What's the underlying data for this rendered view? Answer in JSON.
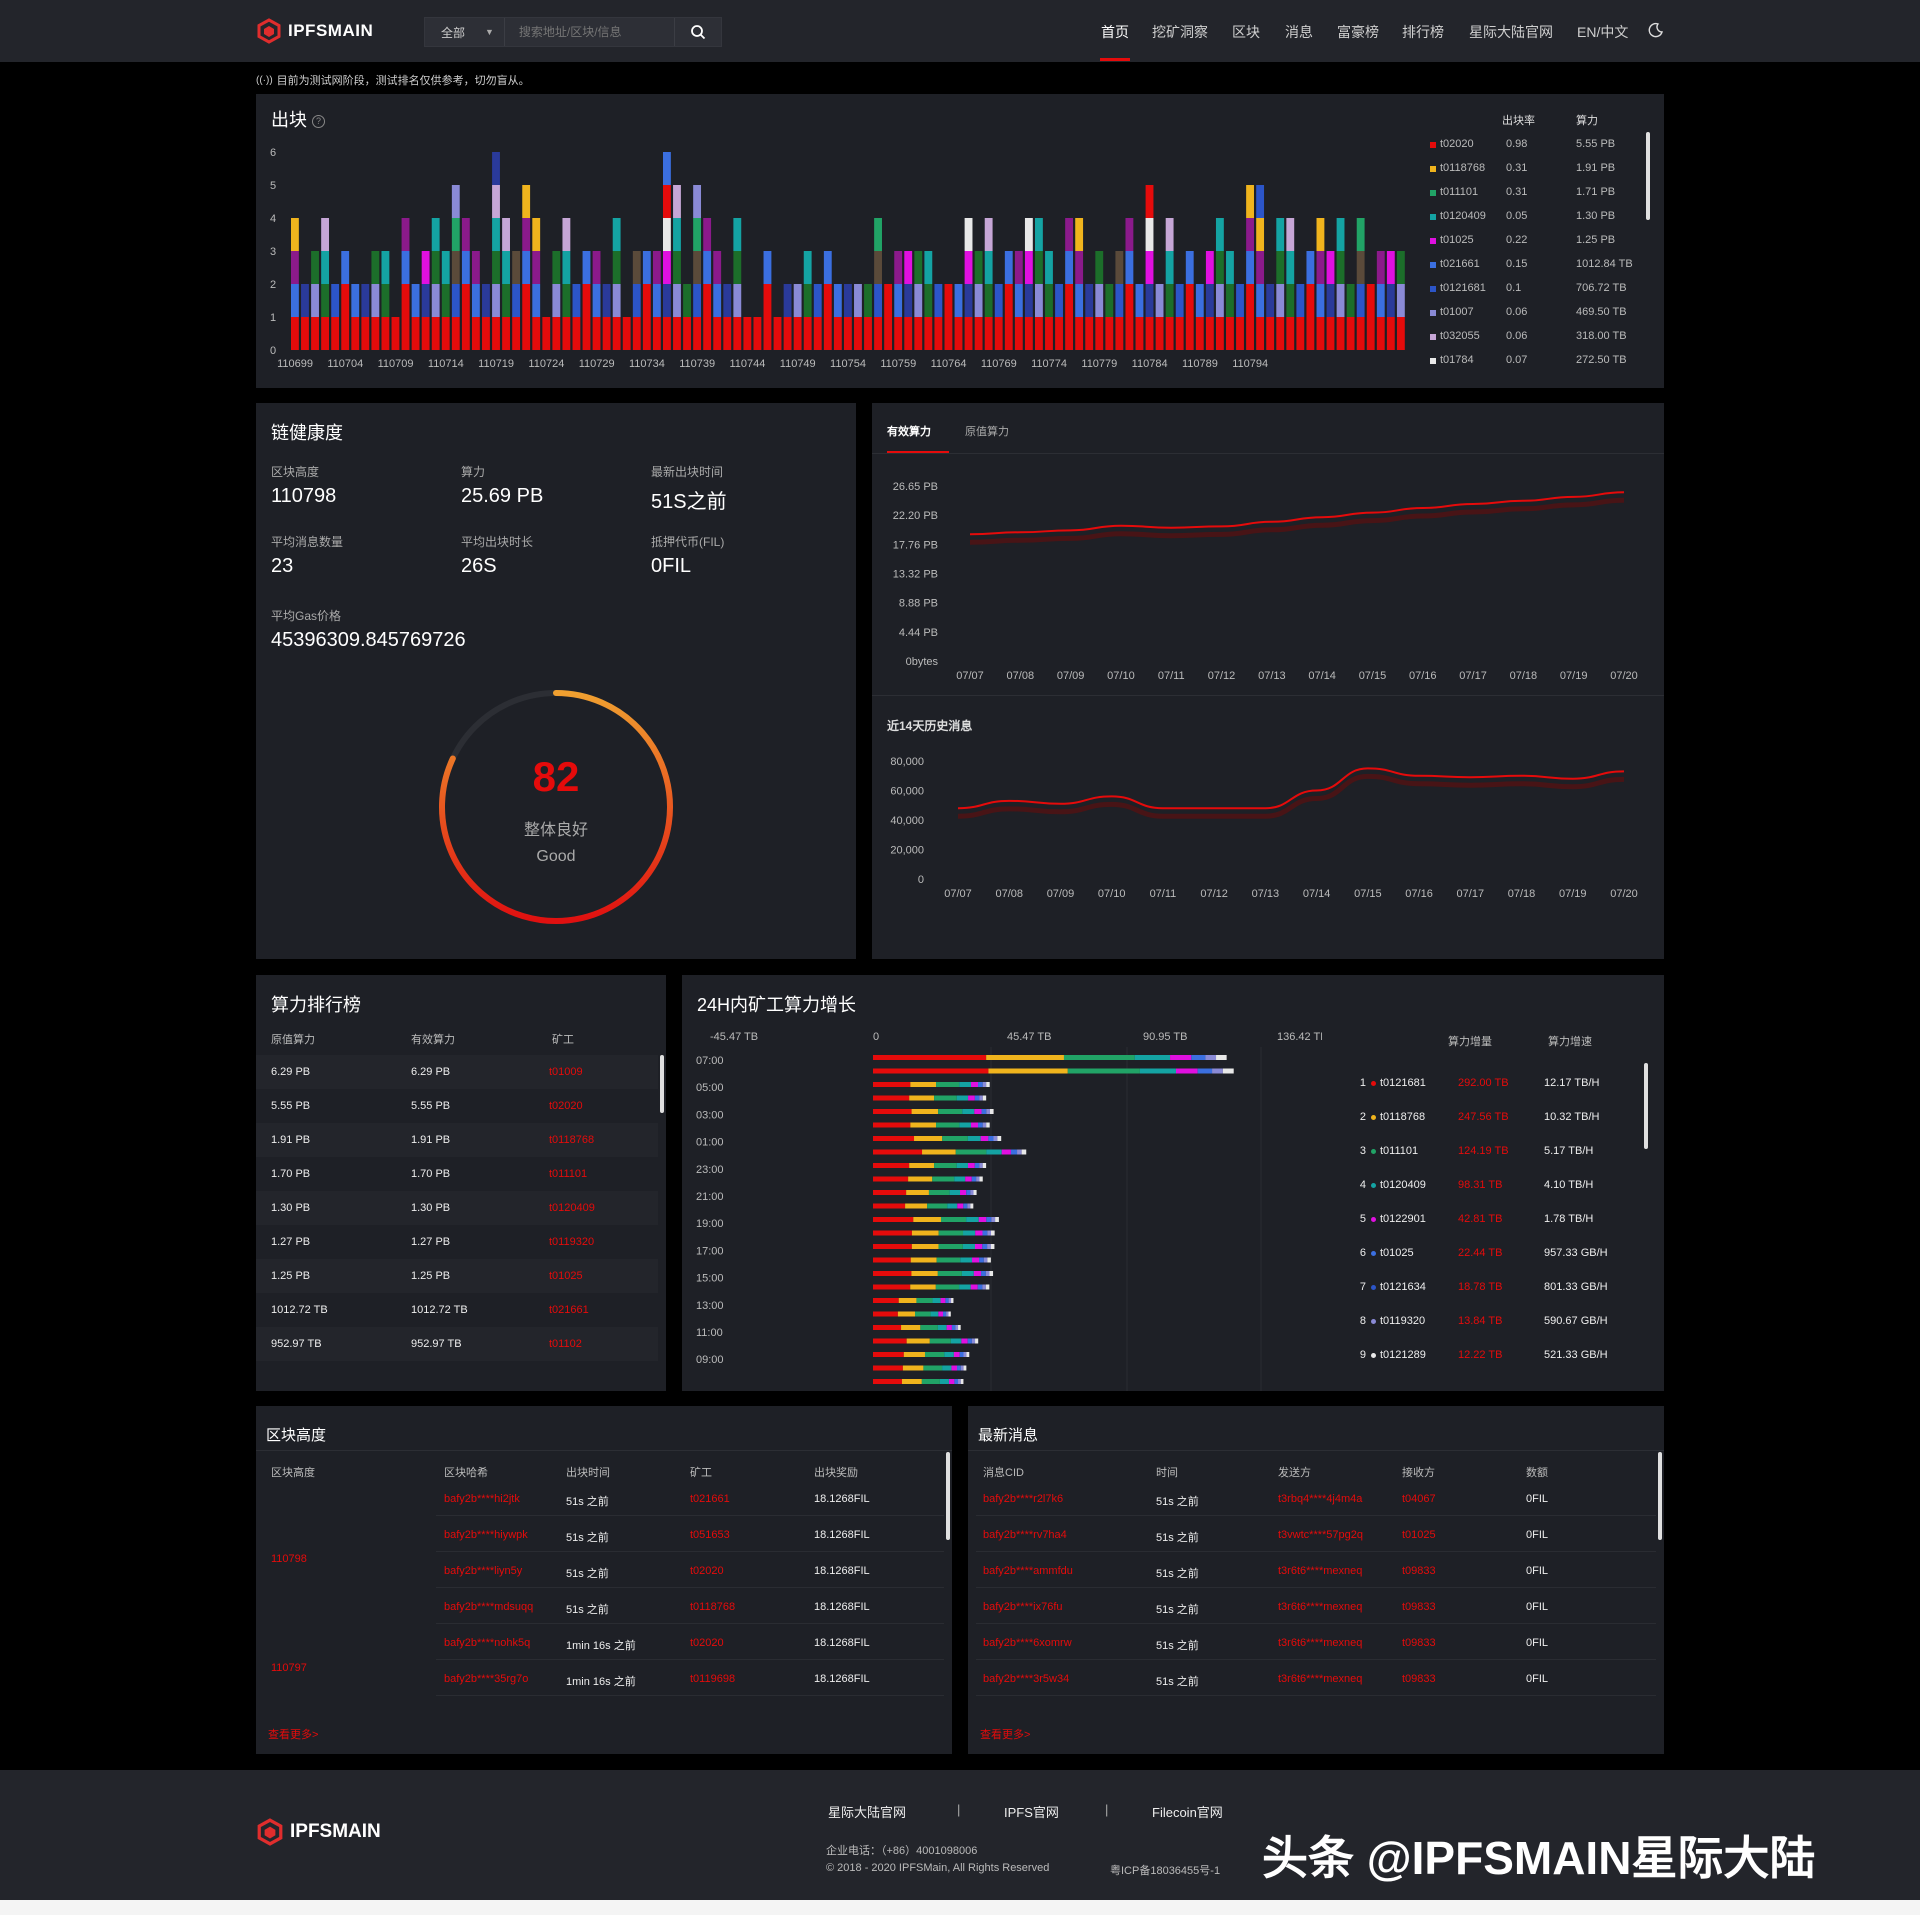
{
  "header": {
    "brand": "IPFSMAIN",
    "search_select": "全部",
    "search_placeholder": "搜索地址/区块/信息",
    "nav": [
      "首页",
      "挖矿洞察",
      "区块",
      "消息",
      "富豪榜",
      "排行榜",
      "星际大陆官网",
      "EN/中文"
    ],
    "active_nav": "首页"
  },
  "notice": "目前为测试网阶段，测试排名仅供参考，切勿盲从。",
  "blocks_chart": {
    "title": "出块",
    "legend_headers": [
      "出块率",
      "算力"
    ],
    "legend": [
      {
        "miner": "t02020",
        "rate": "0.98",
        "power": "5.55 PB",
        "color": "#e50b0b"
      },
      {
        "miner": "t0118768",
        "rate": "0.31",
        "power": "1.91 PB",
        "color": "#f0b41d"
      },
      {
        "miner": "t011101",
        "rate": "0.31",
        "power": "1.71 PB",
        "color": "#21a366"
      },
      {
        "miner": "t0120409",
        "rate": "0.05",
        "power": "1.30 PB",
        "color": "#14a3a3"
      },
      {
        "miner": "t01025",
        "rate": "0.22",
        "power": "1.25 PB",
        "color": "#e010e0"
      },
      {
        "miner": "t021661",
        "rate": "0.15",
        "power": "1012.84 TB",
        "color": "#3b6fe0"
      },
      {
        "miner": "t0121681",
        "rate": "0.1",
        "power": "706.72 TB",
        "color": "#2c55c8"
      },
      {
        "miner": "t01007",
        "rate": "0.06",
        "power": "469.50 TB",
        "color": "#8a8ad6"
      },
      {
        "miner": "t032055",
        "rate": "0.06",
        "power": "318.00 TB",
        "color": "#c6a6d6"
      },
      {
        "miner": "t01784",
        "rate": "0.07",
        "power": "272.50 TB",
        "color": "#e8e8e8"
      }
    ]
  },
  "chart_data": [
    {
      "type": "bar",
      "title": "出块",
      "categories": [
        "110699",
        "110704",
        "110709",
        "110714",
        "110719",
        "110724",
        "110729",
        "110734",
        "110739",
        "110744",
        "110749",
        "110754",
        "110759",
        "110764",
        "110769",
        "110774",
        "110779",
        "110784",
        "110789",
        "110794"
      ],
      "ylim": [
        0,
        6
      ],
      "yticks": [
        "0",
        "1",
        "2",
        "3",
        "4",
        "5",
        "6"
      ],
      "stack_heights": [
        4,
        2,
        3,
        4,
        2,
        3,
        2,
        2,
        3,
        3,
        1,
        4,
        2,
        3,
        4,
        3,
        5,
        4,
        3,
        2,
        6,
        4,
        3,
        5,
        4,
        1,
        3,
        4,
        2,
        3,
        3,
        2,
        4,
        1,
        3,
        3,
        3,
        6,
        5,
        2,
        5,
        4,
        3,
        2,
        4,
        1,
        1,
        3,
        1,
        2,
        2,
        3,
        2,
        3,
        2,
        2,
        2,
        2,
        4,
        2,
        3,
        3,
        3,
        3,
        2,
        2,
        2,
        4,
        3,
        4,
        2,
        3,
        3,
        4,
        4,
        3,
        2,
        4,
        4,
        2,
        3,
        2,
        3,
        4,
        2,
        5,
        2,
        4,
        2,
        3,
        2,
        3,
        4,
        3,
        2,
        5,
        5,
        2,
        4,
        4,
        2,
        3,
        4,
        3,
        4,
        2,
        4,
        2,
        3,
        3,
        3
      ]
    },
    {
      "type": "line",
      "title": "有效算力",
      "x": [
        "07/07",
        "07/08",
        "07/09",
        "07/10",
        "07/11",
        "07/12",
        "07/13",
        "07/14",
        "07/15",
        "07/16",
        "07/17",
        "07/18",
        "07/19",
        "07/20"
      ],
      "y_ticks": [
        "0bytes",
        "4.44 PB",
        "8.88 PB",
        "13.32 PB",
        "17.76 PB",
        "22.20 PB",
        "26.65 PB"
      ],
      "series": [
        {
          "values": [
            19.3,
            19.6,
            19.9,
            20.6,
            20.3,
            20.5,
            21.2,
            21.9,
            22.6,
            23.3,
            23.9,
            24.4,
            25.0,
            25.69
          ]
        }
      ]
    },
    {
      "type": "line",
      "title": "近14天历史消息",
      "x": [
        "07/07",
        "07/08",
        "07/09",
        "07/10",
        "07/11",
        "07/12",
        "07/13",
        "07/14",
        "07/15",
        "07/16",
        "07/17",
        "07/18",
        "07/19",
        "07/20"
      ],
      "y_ticks": [
        "0",
        "20,000",
        "40,000",
        "60,000",
        "80,000"
      ],
      "series": [
        {
          "values": [
            48000,
            53000,
            51000,
            56000,
            48000,
            48000,
            48000,
            60000,
            75000,
            70000,
            69000,
            70000,
            68000,
            73000
          ]
        }
      ]
    },
    {
      "type": "bar",
      "title": "24H内矿工算力增长",
      "x_ticks": [
        "-45.47 TB",
        "0",
        "45.47 TB",
        "90.95 TB",
        "136.42 TB"
      ],
      "categories": [
        "07:00",
        "05:00",
        "03:00",
        "01:00",
        "23:00",
        "21:00",
        "19:00",
        "17:00",
        "15:00",
        "13:00",
        "11:00",
        "09:00"
      ],
      "values": [
        120,
        40,
        44,
        50,
        38,
        37,
        48,
        40,
        42,
        30,
        35,
        33
      ]
    }
  ],
  "health": {
    "title": "链健康度",
    "stats": [
      {
        "label": "区块高度",
        "value": "110798"
      },
      {
        "label": "算力",
        "value": "25.69 PB"
      },
      {
        "label": "最新出块时间",
        "value": "51S之前"
      },
      {
        "label": "平均消息数量",
        "value": "23"
      },
      {
        "label": "平均出块时长",
        "value": "26S"
      },
      {
        "label": "抵押代币(FIL)",
        "value": "0FIL"
      }
    ],
    "gas_label": "平均Gas价格",
    "gas_value": "45396309.845769726",
    "score": "82",
    "score_text": "整体良好",
    "score_en": "Good",
    "score_fraction": 0.82
  },
  "power_tabs": [
    "有效算力",
    "原值算力"
  ],
  "messages_chart_title": "近14天历史消息",
  "ranking": {
    "title": "算力排行榜",
    "headers": [
      "原值算力",
      "有效算力",
      "矿工"
    ],
    "rows": [
      [
        "6.29 PB",
        "6.29 PB",
        "t01009"
      ],
      [
        "5.55 PB",
        "5.55 PB",
        "t02020"
      ],
      [
        "1.91 PB",
        "1.91 PB",
        "t0118768"
      ],
      [
        "1.70 PB",
        "1.70 PB",
        "t011101"
      ],
      [
        "1.30 PB",
        "1.30 PB",
        "t0120409"
      ],
      [
        "1.27 PB",
        "1.27 PB",
        "t0119320"
      ],
      [
        "1.25 PB",
        "1.25 PB",
        "t01025"
      ],
      [
        "1012.72 TB",
        "1012.72 TB",
        "t021661"
      ],
      [
        "952.97 TB",
        "952.97 TB",
        "t01102"
      ]
    ]
  },
  "growth": {
    "title": "24H内矿工算力增长",
    "headers": [
      "算力增量",
      "算力增速"
    ],
    "rows": [
      {
        "rank": "1",
        "miner": "t0121681",
        "inc": "292.00 TB",
        "speed": "12.17 TB/H",
        "color": "#e50b0b"
      },
      {
        "rank": "2",
        "miner": "t0118768",
        "inc": "247.56 TB",
        "speed": "10.32 TB/H",
        "color": "#f0b41d"
      },
      {
        "rank": "3",
        "miner": "t011101",
        "inc": "124.19 TB",
        "speed": "5.17 TB/H",
        "color": "#21a366"
      },
      {
        "rank": "4",
        "miner": "t0120409",
        "inc": "98.31 TB",
        "speed": "4.10 TB/H",
        "color": "#14a3a3"
      },
      {
        "rank": "5",
        "miner": "t0122901",
        "inc": "42.81 TB",
        "speed": "1.78 TB/H",
        "color": "#e010e0"
      },
      {
        "rank": "6",
        "miner": "t01025",
        "inc": "22.44 TB",
        "speed": "957.33 GB/H",
        "color": "#3b6fe0"
      },
      {
        "rank": "7",
        "miner": "t0121634",
        "inc": "18.78 TB",
        "speed": "801.33 GB/H",
        "color": "#2c55c8"
      },
      {
        "rank": "8",
        "miner": "t0119320",
        "inc": "13.84 TB",
        "speed": "590.67 GB/H",
        "color": "#8a8ad6"
      },
      {
        "rank": "9",
        "miner": "t0121289",
        "inc": "12.22 TB",
        "speed": "521.33 GB/H",
        "color": "#e8e8e8"
      }
    ]
  },
  "blocks_table": {
    "title": "区块高度",
    "headers": [
      "区块高度",
      "区块哈希",
      "出块时间",
      "矿工",
      "出块奖励"
    ],
    "heights": [
      "110798",
      "110797"
    ],
    "rows": [
      [
        "bafy2b****hi2jtk",
        "51s 之前",
        "t021661",
        "18.1268FIL"
      ],
      [
        "bafy2b****hiywpk",
        "51s 之前",
        "t051653",
        "18.1268FIL"
      ],
      [
        "bafy2b****liyn5y",
        "51s 之前",
        "t02020",
        "18.1268FIL"
      ],
      [
        "bafy2b****mdsuqq",
        "51s 之前",
        "t0118768",
        "18.1268FIL"
      ],
      [
        "bafy2b****nohk5q",
        "1min 16s 之前",
        "t02020",
        "18.1268FIL"
      ],
      [
        "bafy2b****35rg7o",
        "1min 16s 之前",
        "t0119698",
        "18.1268FIL"
      ]
    ],
    "more": "查看更多>"
  },
  "messages_table": {
    "title": "最新消息",
    "headers": [
      "消息CID",
      "时间",
      "发送方",
      "接收方",
      "数额"
    ],
    "rows": [
      [
        "bafy2b****r2l7k6",
        "51s 之前",
        "t3rbq4****4j4m4a",
        "t04067",
        "0FIL"
      ],
      [
        "bafy2b****rv7ha4",
        "51s 之前",
        "t3vwtc****57pg2q",
        "t01025",
        "0FIL"
      ],
      [
        "bafy2b****ammfdu",
        "51s 之前",
        "t3r6t6****mexneq",
        "t09833",
        "0FIL"
      ],
      [
        "bafy2b****ix76fu",
        "51s 之前",
        "t3r6t6****mexneq",
        "t09833",
        "0FIL"
      ],
      [
        "bafy2b****6xomrw",
        "51s 之前",
        "t3r6t6****mexneq",
        "t09833",
        "0FIL"
      ],
      [
        "bafy2b****3r5w34",
        "51s 之前",
        "t3r6t6****mexneq",
        "t09833",
        "0FIL"
      ]
    ],
    "more": "查看更多>"
  },
  "footer": {
    "brand": "IPFSMAIN",
    "links": [
      "星际大陆官网",
      "IPFS官网",
      "Filecoin官网"
    ],
    "phone": "企业电话：（+86）4001098006",
    "copyright": "© 2018 - 2020 IPFSMain, All Rights Reserved",
    "icp": "粤ICP备18036455号-1",
    "watermark": "头条 @IPFSMAIN星际大陆"
  }
}
